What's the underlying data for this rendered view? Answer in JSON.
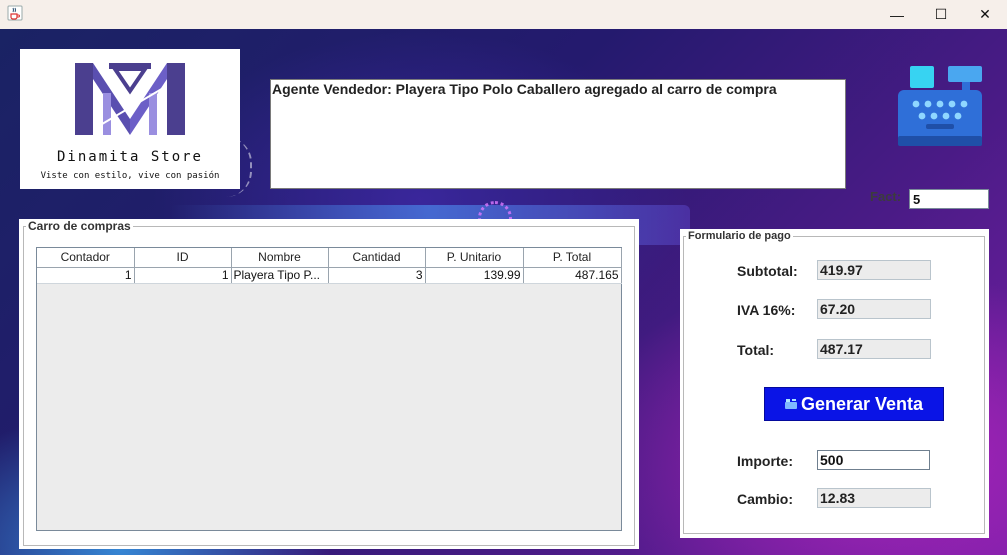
{
  "window": {
    "minimize_glyph": "—",
    "maximize_glyph": "☐",
    "close_glyph": "✕",
    "app_icon": "java-cup-icon"
  },
  "logo": {
    "name": "Dinamita Store",
    "slogan": "Viste con estilo, vive con pasión",
    "colors": [
      "#4b3f8f",
      "#6c5fc7",
      "#9a8fe0"
    ]
  },
  "message": {
    "text": "Agente Vendedor: Playera Tipo Polo Caballero agregado al carro de compra"
  },
  "fact": {
    "label": "Fact:",
    "value": "5"
  },
  "cart": {
    "title": "Carro de compras",
    "columns": [
      "Contador",
      "ID",
      "Nombre",
      "Cantidad",
      "P. Unitario",
      "P. Total"
    ],
    "rows": [
      [
        "1",
        "1",
        "Playera Tipo P...",
        "3",
        "139.99",
        "487.165"
      ]
    ]
  },
  "payment": {
    "title": "Formulario de pago",
    "subtotal_label": "Subtotal:",
    "subtotal_value": "419.97",
    "iva_label": "IVA 16%:",
    "iva_value": "67.20",
    "total_label": "Total:",
    "total_value": "487.17",
    "generate_button": "Generar Venta",
    "importe_label": "Importe:",
    "importe_value": "500",
    "cambio_label": "Cambio:",
    "cambio_value": "12.83"
  },
  "colors": {
    "button_blue": "#0a14e6",
    "register_blue": "#2f6fd8",
    "register_cyan": "#37d3f2"
  }
}
